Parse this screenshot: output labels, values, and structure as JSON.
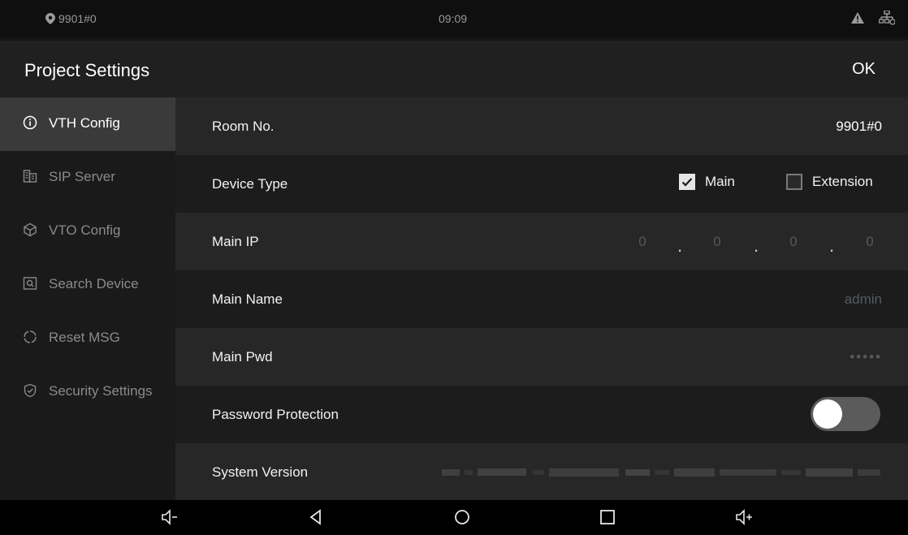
{
  "status": {
    "location": "9901#0",
    "time": "09:09",
    "icons": [
      "warning-icon",
      "network-icon"
    ]
  },
  "header": {
    "title": "Project Settings",
    "ok_label": "OK"
  },
  "sidebar": {
    "items": [
      {
        "label": "VTH Config",
        "icon": "info-icon",
        "active": true
      },
      {
        "label": "SIP Server",
        "icon": "building-icon",
        "active": false
      },
      {
        "label": "VTO Config",
        "icon": "cube-icon",
        "active": false
      },
      {
        "label": "Search Device",
        "icon": "search-window-icon",
        "active": false
      },
      {
        "label": "Reset MSG",
        "icon": "reset-icon",
        "active": false
      },
      {
        "label": "Security Settings",
        "icon": "shield-check-icon",
        "active": false
      }
    ]
  },
  "rows": {
    "room_no": {
      "label": "Room No.",
      "value": "9901#0"
    },
    "device_type": {
      "label": "Device Type",
      "option_main": "Main",
      "option_extension": "Extension",
      "selected": "Main"
    },
    "main_ip": {
      "label": "Main IP",
      "octets": [
        "0",
        "0",
        "0",
        "0"
      ],
      "separator": "."
    },
    "main_name": {
      "label": "Main Name",
      "placeholder": "admin"
    },
    "main_pwd": {
      "label": "Main Pwd",
      "placeholder": "•••••"
    },
    "password_protection": {
      "label": "Password Protection",
      "enabled": false
    },
    "system_version": {
      "label": "System Version"
    }
  },
  "navbar": {
    "buttons": [
      "volume-down-icon",
      "back-icon",
      "home-icon",
      "recents-icon",
      "volume-up-icon"
    ]
  },
  "colors": {
    "background": "#141414",
    "header": "#202020",
    "active_item": "#3a3a3a",
    "row_even": "#272727",
    "row_odd": "#1c1c1c",
    "muted_text": "#55595e"
  }
}
